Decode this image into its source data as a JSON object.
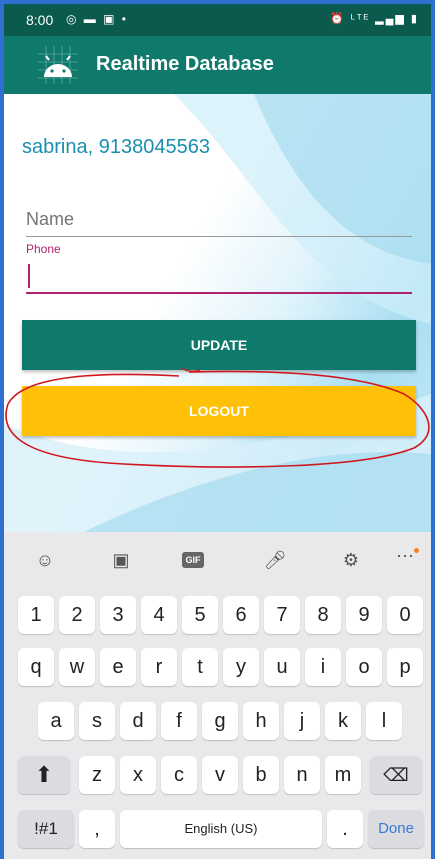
{
  "status_bar": {
    "time": "8:00"
  },
  "app_bar": {
    "title": "Realtime Database"
  },
  "user_line": "sabrina, 9138045563",
  "form": {
    "name_placeholder": "Name",
    "phone_label": "Phone",
    "update_label": "UPDATE",
    "logout_label": "LOGOUT"
  },
  "keyboard": {
    "number_row": [
      "1",
      "2",
      "3",
      "4",
      "5",
      "6",
      "7",
      "8",
      "9",
      "0"
    ],
    "row1": [
      "q",
      "w",
      "e",
      "r",
      "t",
      "y",
      "u",
      "i",
      "o",
      "p"
    ],
    "row2": [
      "a",
      "s",
      "d",
      "f",
      "g",
      "h",
      "j",
      "k",
      "l"
    ],
    "row3": [
      "z",
      "x",
      "c",
      "v",
      "b",
      "n",
      "m"
    ],
    "symbols_label": "!#1",
    "comma": ",",
    "space_label": "English (US)",
    "period": ".",
    "done_label": "Done",
    "gif_label": "GIF"
  },
  "colors": {
    "app_bar": "#0f7a6b",
    "status_bar": "#0a5a4e",
    "update_button": "#0f7a6b",
    "logout_button": "#ffc107",
    "user_text": "#1a8fb0",
    "phone_accent": "#b0236c",
    "annotation": "#d0181e"
  }
}
